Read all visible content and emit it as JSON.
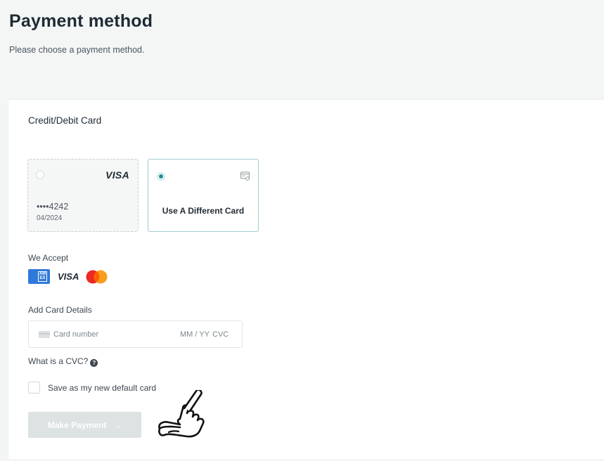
{
  "header": {
    "title": "Payment method",
    "subtitle": "Please choose a payment method."
  },
  "card_section": {
    "title": "Credit/Debit Card",
    "saved_card": {
      "brand": "VISA",
      "number": "••••4242",
      "expiry": "04/2024",
      "selected": false
    },
    "new_card": {
      "label": "Use A Different Card",
      "selected": true,
      "icon": "card-outline-icon"
    },
    "accent_color": "#1c8e97"
  },
  "we_accept": {
    "label": "We Accept",
    "logos": [
      "amex-logo",
      "visa-logo",
      "mastercard-logo"
    ],
    "visa_text": "VISA",
    "amex_text": "AM EX"
  },
  "card_details": {
    "label": "Add Card Details",
    "number_placeholder": "Card number",
    "expiry_placeholder": "MM / YY",
    "cvc_placeholder": "CVC"
  },
  "cvc_help": {
    "label": "What is a CVC?",
    "icon_glyph": "?"
  },
  "save_default": {
    "label": "Save as my new default card",
    "checked": false
  },
  "submit": {
    "label": "Make Payment",
    "arrow": "→",
    "enabled": false
  }
}
